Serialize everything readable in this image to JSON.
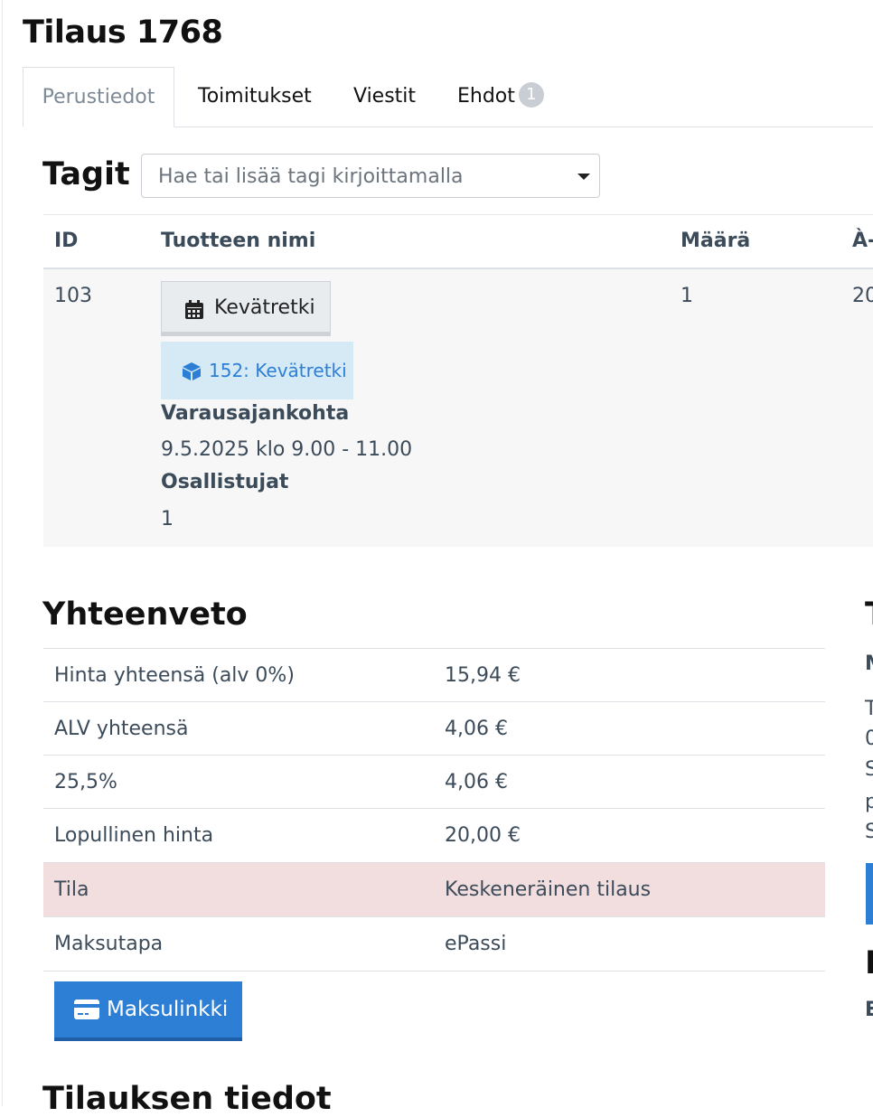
{
  "page": {
    "title": "Tilaus 1768"
  },
  "tabs": [
    {
      "label": "Perustiedot"
    },
    {
      "label": "Toimitukset"
    },
    {
      "label": "Viestit"
    },
    {
      "label": "Ehdot",
      "badge": "1"
    }
  ],
  "tags": {
    "label": "Tagit",
    "placeholder": "Hae tai lisää tagi kirjoittamalla"
  },
  "products": {
    "headers": [
      "ID",
      "Tuotteen nimi",
      "Määrä",
      "À-"
    ],
    "rows": [
      {
        "id": "103",
        "event_button": "Kevätretki",
        "product_link": "152: Kevätretki",
        "booking_time_label": "Varausajankohta",
        "booking_time": "9.5.2025 klo 9.00 - 11.00",
        "participants_label": "Osallistujat",
        "participants": "1",
        "quantity": "1",
        "unit_price": "20"
      }
    ]
  },
  "summary": {
    "title": "Yhteenveto",
    "rows": [
      {
        "label": "Hinta yhteensä (alv 0%)",
        "value": "15,94 €"
      },
      {
        "label": "ALV yhteensä",
        "value": "4,06 €"
      },
      {
        "label": "25,5%",
        "value": "4,06 €"
      },
      {
        "label": "Lopullinen hinta",
        "value": "20,00 €"
      },
      {
        "label": "Tila",
        "value": "Keskeneräinen tilaus"
      },
      {
        "label": "Maksutapa",
        "value": "ePassi"
      }
    ],
    "payment_link_button": "Maksulinkki"
  },
  "order_info": {
    "title": "Tilauksen tiedot"
  },
  "right_panel": {
    "title_fragment": "T",
    "subtitle_fragment": "M",
    "text_lines": [
      "T",
      "0",
      "S",
      "p",
      "S"
    ],
    "second_title_fragment": "L",
    "second_text_fragment": "E"
  },
  "colors": {
    "primary": "#2d7fd5",
    "status_bg": "#f2dede",
    "chip_bg": "#d6eaf6"
  }
}
